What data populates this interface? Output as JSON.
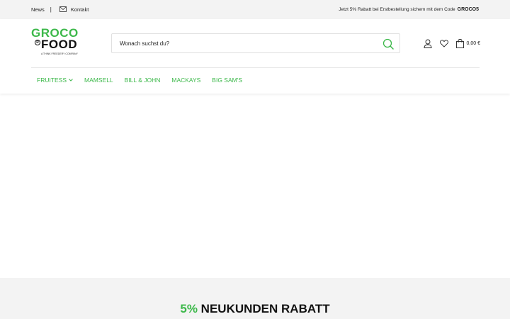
{
  "topbar": {
    "news": "News",
    "separator": "|",
    "contact": "Kontakt",
    "promo_text": "Jetzt 5% Rabatt bei Erstbestellung sichern mit dem Code",
    "promo_code": "GROCO5"
  },
  "logo": {
    "line1": "GROCO",
    "registered": "R",
    "line2": "FOOD",
    "tagline": "A THINK FREEDERY COMPANY"
  },
  "search": {
    "placeholder": "Wonach suchst du?",
    "value": ""
  },
  "header": {
    "cart_total": "0,00 €",
    "icons": [
      "user-icon",
      "heart-icon",
      "cart-icon"
    ]
  },
  "nav": {
    "items": [
      {
        "label": "FRUITESS",
        "has_dropdown": true
      },
      {
        "label": "MAMSELL"
      },
      {
        "label": "BILL & JOHN"
      },
      {
        "label": "MACKAYS"
      },
      {
        "label": "BIG SAM'S"
      }
    ]
  },
  "promo_banner": {
    "percent": "5%",
    "text": "NEUKUNDEN RABATT"
  },
  "colors": {
    "brand_green": "#3cb84a",
    "topbar_bg": "#f3f3f3"
  }
}
